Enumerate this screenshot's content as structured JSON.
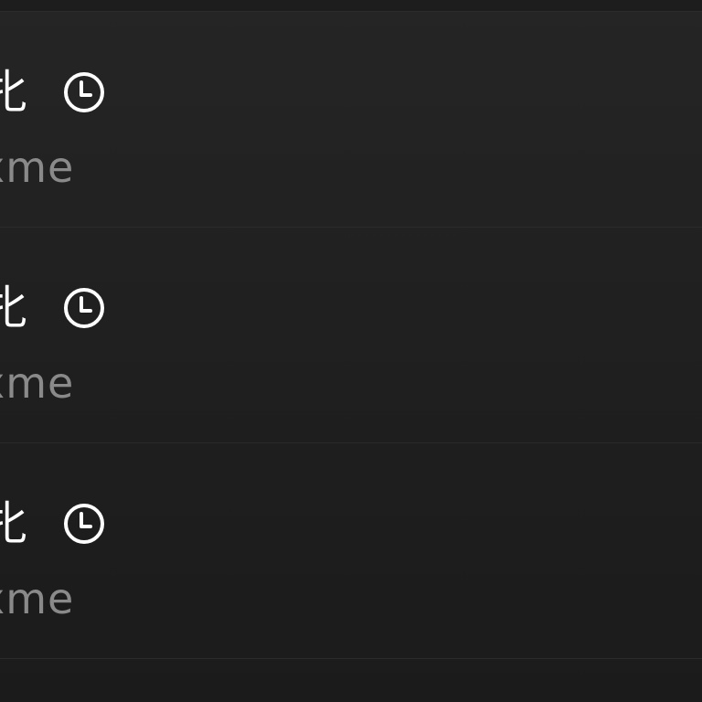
{
  "items": [
    {
      "title": "牝",
      "subtitle": "xme",
      "icon": "clock-icon"
    },
    {
      "title": "牝",
      "subtitle": "xme",
      "icon": "clock-icon"
    },
    {
      "title": "牝",
      "subtitle": "xme",
      "icon": "clock-icon"
    }
  ],
  "colors": {
    "background": "#1f1f1f",
    "title": "#ffffff",
    "subtitle": "#8a8a8a",
    "divider": "#2b2b2b"
  }
}
